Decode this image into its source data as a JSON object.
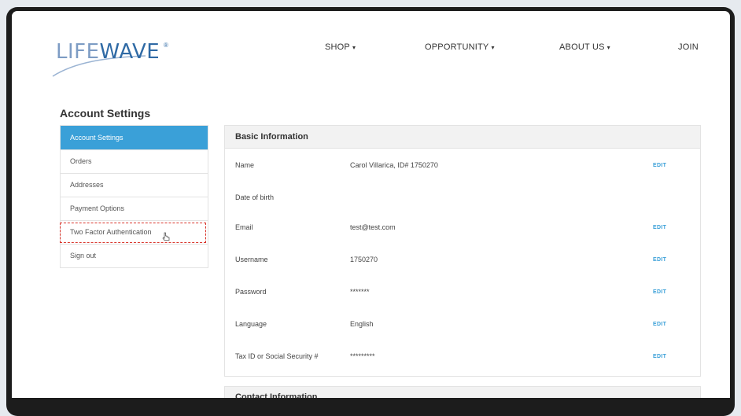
{
  "header": {
    "logo_text_light": "LIFE",
    "logo_text_dark": "WAVE",
    "logo_reg": "®",
    "nav": [
      {
        "label": "SHOP",
        "caret": "▾"
      },
      {
        "label": "OPPORTUNITY",
        "caret": "▾"
      },
      {
        "label": "ABOUT US",
        "caret": "▾"
      },
      {
        "label": "JOIN"
      }
    ]
  },
  "page_title": "Account Settings",
  "sidebar": {
    "items": [
      {
        "label": "Account Settings",
        "active": true
      },
      {
        "label": "Orders"
      },
      {
        "label": "Addresses"
      },
      {
        "label": "Payment Options"
      },
      {
        "label": "Two Factor Authentication",
        "highlighted": true
      },
      {
        "label": "Sign out"
      }
    ]
  },
  "basic_info": {
    "title": "Basic Information",
    "edit_label": "EDIT",
    "rows": [
      {
        "label": "Name",
        "value": "Carol Villarica, ID# 1750270",
        "editable": true
      },
      {
        "label": "Date of birth",
        "value": "",
        "editable": false
      },
      {
        "label": "Email",
        "value": "test@test.com",
        "editable": true
      },
      {
        "label": "Username",
        "value": "1750270",
        "editable": true
      },
      {
        "label": "Password",
        "value": "*******",
        "editable": true
      },
      {
        "label": "Language",
        "value": "English",
        "editable": true
      },
      {
        "label": "Tax ID or Social Security #",
        "value": "*********",
        "editable": true
      }
    ]
  },
  "contact_info": {
    "title": "Contact Information"
  },
  "colors": {
    "accent": "#3aa0d8",
    "highlight_border": "#d9342b",
    "logo_light": "#7d9cc4",
    "logo_dark": "#2f6aa5"
  },
  "icons": {
    "cursor": "hand-pointer-icon",
    "caret": "caret-down-icon"
  }
}
